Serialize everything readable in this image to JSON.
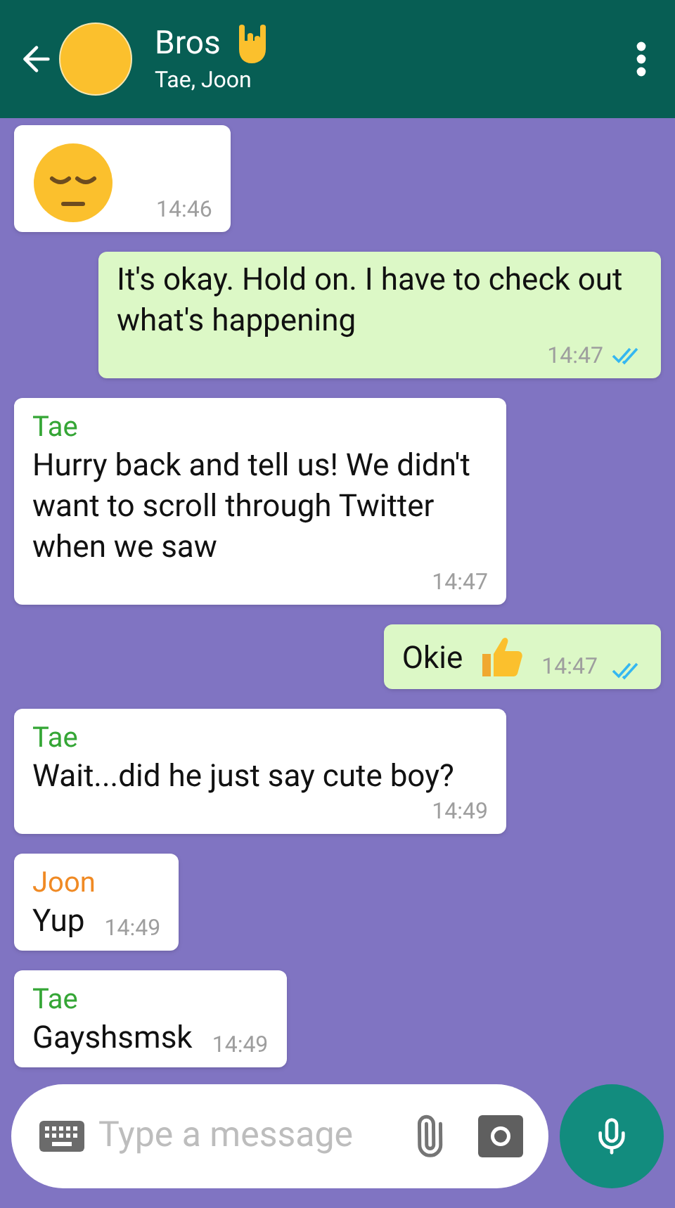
{
  "header": {
    "title": "Bros",
    "subtitle": "Tae, Joon"
  },
  "messages": [
    {
      "outgoing": false,
      "kind": "emoji",
      "time": "14:46"
    },
    {
      "outgoing": true,
      "kind": "text",
      "text": "It's okay. Hold on. I have to check out what's happening",
      "time": "14:47",
      "read": true
    },
    {
      "outgoing": false,
      "kind": "text",
      "sender": "Tae",
      "color": "#35a636",
      "text": "Hurry back and tell us! We didn't want to scroll through Twitter when we saw",
      "time": "14:47"
    },
    {
      "outgoing": true,
      "kind": "text_with_emoji",
      "text": "Okie",
      "time": "14:47",
      "read": true
    },
    {
      "outgoing": false,
      "kind": "text",
      "sender": "Tae",
      "color": "#35a636",
      "text": "Wait...did he just say cute boy?",
      "time": "14:49"
    },
    {
      "outgoing": false,
      "kind": "text",
      "sender": "Joon",
      "color": "#f08a24",
      "text": "Yup",
      "time": "14:49"
    },
    {
      "outgoing": false,
      "kind": "text",
      "sender": "Tae",
      "color": "#35a636",
      "text": "Gayshsmsk",
      "time": "14:49"
    }
  ],
  "composer": {
    "placeholder": "Type a message"
  }
}
